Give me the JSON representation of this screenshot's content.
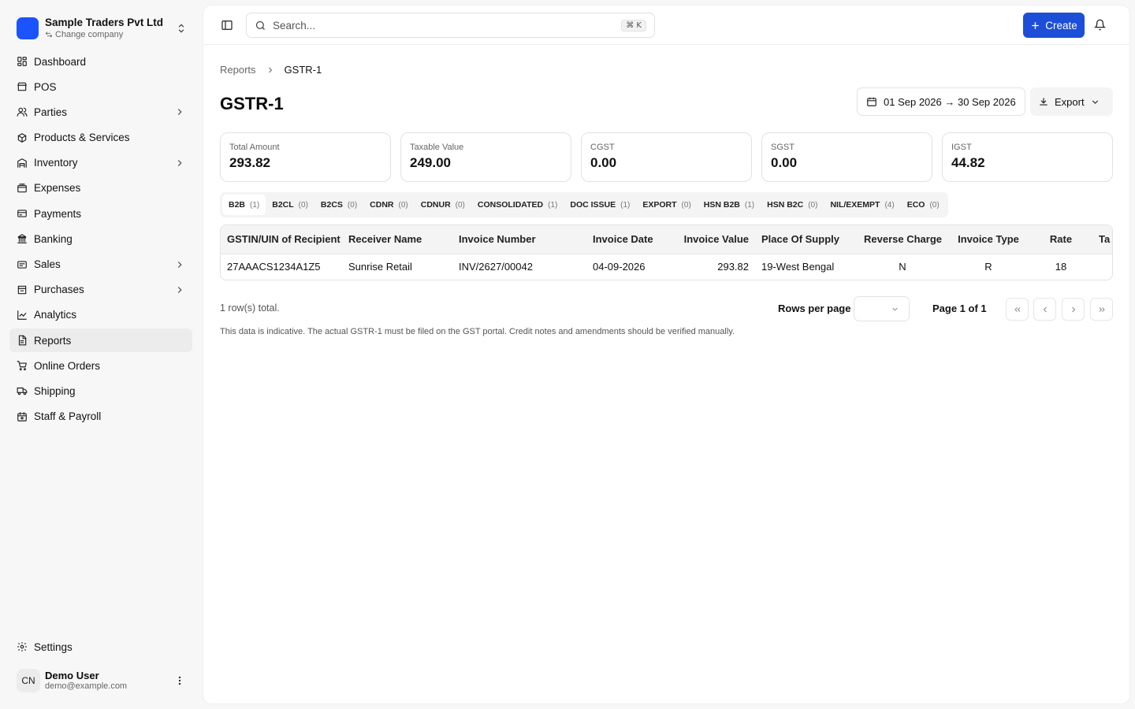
{
  "company": {
    "name": "Sample Traders Pvt Ltd",
    "change_label": "Change company"
  },
  "nav": [
    {
      "label": "Dashboard",
      "icon": "dashboard-icon",
      "has_children": false,
      "active": false
    },
    {
      "label": "POS",
      "icon": "store-icon",
      "has_children": false,
      "active": false
    },
    {
      "label": "Parties",
      "icon": "users-icon",
      "has_children": true,
      "active": false
    },
    {
      "label": "Products & Services",
      "icon": "package-icon",
      "has_children": false,
      "active": false
    },
    {
      "label": "Inventory",
      "icon": "warehouse-icon",
      "has_children": true,
      "active": false
    },
    {
      "label": "Expenses",
      "icon": "wallet-icon",
      "has_children": false,
      "active": false
    },
    {
      "label": "Payments",
      "icon": "credit-card-icon",
      "has_children": false,
      "active": false
    },
    {
      "label": "Banking",
      "icon": "bank-icon",
      "has_children": false,
      "active": false
    },
    {
      "label": "Sales",
      "icon": "sales-icon",
      "has_children": true,
      "active": false
    },
    {
      "label": "Purchases",
      "icon": "purchases-icon",
      "has_children": true,
      "active": false
    },
    {
      "label": "Analytics",
      "icon": "line-chart-icon",
      "has_children": false,
      "active": false
    },
    {
      "label": "Reports",
      "icon": "report-file-icon",
      "has_children": false,
      "active": true
    },
    {
      "label": "Online Orders",
      "icon": "cart-icon",
      "has_children": false,
      "active": false
    },
    {
      "label": "Shipping",
      "icon": "truck-icon",
      "has_children": false,
      "active": false
    },
    {
      "label": "Staff & Payroll",
      "icon": "calendar-user-icon",
      "has_children": false,
      "active": false
    }
  ],
  "settings_label": "Settings",
  "user": {
    "initials": "CN",
    "name": "Demo User",
    "email": "demo@example.com"
  },
  "topbar": {
    "search_placeholder": "Search...",
    "shortcut": "⌘ K",
    "create_label": "Create"
  },
  "breadcrumb": {
    "parent": "Reports",
    "current": "GSTR-1"
  },
  "page_title": "GSTR-1",
  "date_range": "01 Sep 2026 → 30 Sep 2026",
  "export_label": "Export",
  "stats": [
    {
      "label": "Total Amount",
      "value": "293.82"
    },
    {
      "label": "Taxable Value",
      "value": "249.00"
    },
    {
      "label": "CGST",
      "value": "0.00"
    },
    {
      "label": "SGST",
      "value": "0.00"
    },
    {
      "label": "IGST",
      "value": "44.82"
    }
  ],
  "tabs": [
    {
      "label": "B2B",
      "count": "(1)",
      "active": true
    },
    {
      "label": "B2CL",
      "count": "(0)",
      "active": false
    },
    {
      "label": "B2CS",
      "count": "(0)",
      "active": false
    },
    {
      "label": "CDNR",
      "count": "(0)",
      "active": false
    },
    {
      "label": "CDNUR",
      "count": "(0)",
      "active": false
    },
    {
      "label": "CONSOLIDATED",
      "count": "(1)",
      "active": false
    },
    {
      "label": "DOC ISSUE",
      "count": "(1)",
      "active": false
    },
    {
      "label": "EXPORT",
      "count": "(0)",
      "active": false
    },
    {
      "label": "HSN B2B",
      "count": "(1)",
      "active": false
    },
    {
      "label": "HSN B2C",
      "count": "(0)",
      "active": false
    },
    {
      "label": "NIL/EXEMPT",
      "count": "(4)",
      "active": false
    },
    {
      "label": "ECO",
      "count": "(0)",
      "active": false
    }
  ],
  "table": {
    "columns": [
      "GSTIN/UIN of Recipient",
      "Receiver Name",
      "Invoice Number",
      "Invoice Date",
      "Invoice Value",
      "Place Of Supply",
      "Reverse Charge",
      "Invoice Type",
      "Rate",
      "Ta"
    ],
    "rows": [
      [
        "27AAACS1234A1Z5",
        "Sunrise Retail",
        "INV/2627/00042",
        "04-09-2026",
        "293.82",
        "19-West Bengal",
        "N",
        "R",
        "18",
        ""
      ]
    ]
  },
  "pagination": {
    "row_count": "1 row(s) total.",
    "rows_per_page_label": "Rows per page",
    "page_info": "Page 1 of 1"
  },
  "note": "This data is indicative. The actual GSTR-1 must be filed on the GST portal. Credit notes and amendments should be verified manually.",
  "colors": {
    "accent": "#1d4ed8",
    "logo": "#1a53ff"
  }
}
